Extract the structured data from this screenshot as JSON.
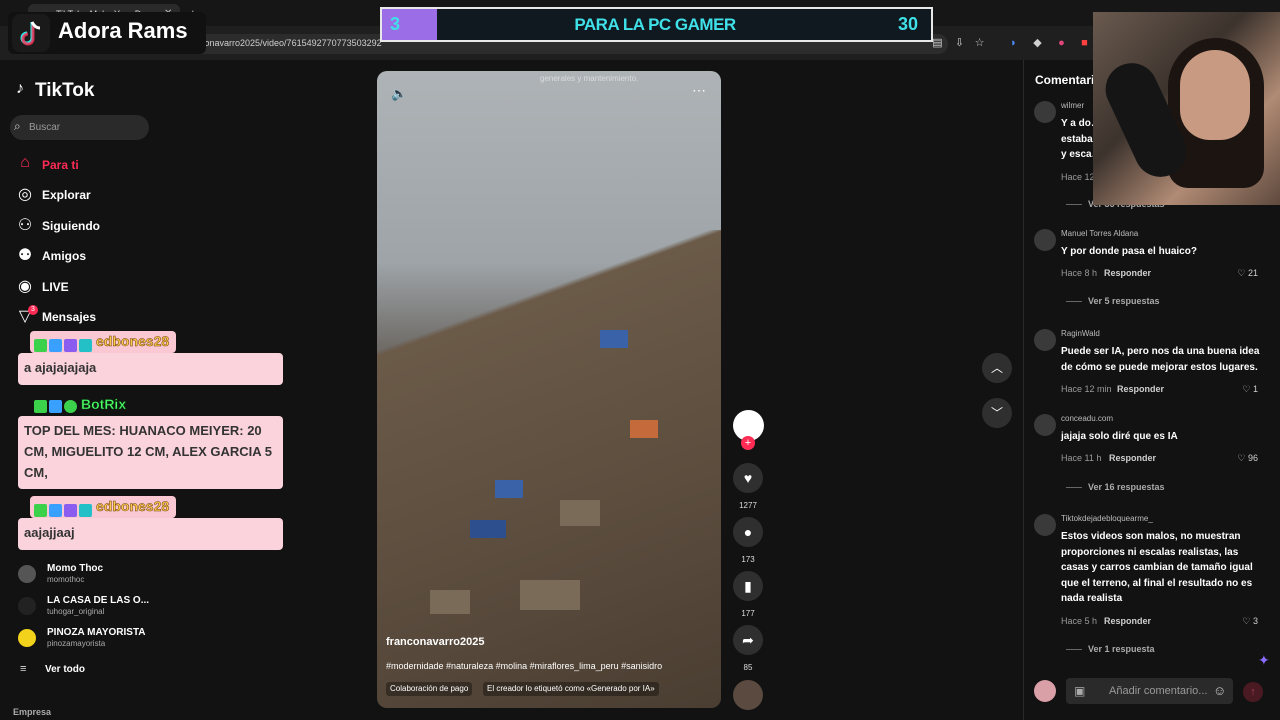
{
  "browser": {
    "tab_title": "TikTok - Make Your Day",
    "url": "conavarro2025/video/7615492770773503292"
  },
  "overlay": {
    "streamer_name": "Adora Rams",
    "goal_current": "3",
    "goal_title": "PARA LA PC GAMER",
    "goal_target": "30",
    "goal_progress": 0.1
  },
  "sidebar": {
    "logo": "TikTok",
    "search_placeholder": "Buscar",
    "nav": [
      {
        "label": "Para ti",
        "icon": "home-icon"
      },
      {
        "label": "Explorar",
        "icon": "compass-icon"
      },
      {
        "label": "Siguiendo",
        "icon": "following-icon"
      },
      {
        "label": "Amigos",
        "icon": "friends-icon"
      },
      {
        "label": "LIVE",
        "icon": "live-icon"
      },
      {
        "label": "Mensajes",
        "icon": "messages-icon",
        "badge": "3"
      }
    ],
    "accounts": [
      {
        "name": "Momo Thoc",
        "handle": "momothoc"
      },
      {
        "name": "LA CASA DE LAS O...",
        "handle": "tuhogar_original"
      },
      {
        "name": "PINOZA MAYORISTA",
        "handle": "pinozamayorista"
      }
    ],
    "see_all": "Ver todo",
    "footer": "Empresa"
  },
  "chat": [
    {
      "user": "edbones28",
      "message": "a ajajajajaja"
    },
    {
      "user": "BotRix",
      "message": "TOP DEL MES: HUANACO MEIYER: 20 CM, MIGUELITO 12 CM, ALEX GARCIA 5 CM,"
    },
    {
      "user": "edbones28",
      "message": "aajajjaaj"
    }
  ],
  "video": {
    "overlay_text": "generales y mantenimiento.",
    "author": "franconavarro2025",
    "hashtags": "#modernidade  #naturaleza #molina #miraflores_lima_peru #sanisidro",
    "chip_paid": "Colaboración de pago",
    "chip_ai": "El creador lo etiquetó como «Generado por IA»",
    "likes": "1277",
    "comments": "173",
    "saves": "177",
    "shares": "85"
  },
  "comments": {
    "title": "Comentarios",
    "items": [
      {
        "user": "wilmer",
        "text": "Y a do… estaba… y esca…",
        "time": "Hace 12",
        "more": "Ver 36 respuestas"
      },
      {
        "user": "Manuel Torres Aldana",
        "text": "Y por donde pasa el huaico?",
        "time": "Hace 8 h",
        "likes": "21",
        "more": "Ver 5 respuestas"
      },
      {
        "user": "RaginWald",
        "text": "Puede ser IA, pero nos da una buena idea de cómo se puede mejorar estos lugares.",
        "time": "Hace 12 min",
        "likes": "1"
      },
      {
        "user": "conceadu.com",
        "text": "jajaja solo diré que es IA",
        "time": "Hace 11 h",
        "likes": "96",
        "more": "Ver 16 respuestas"
      },
      {
        "user": "Tiktokdejadebloquearme_",
        "text": "Estos videos son malos, no muestran proporciones ni escalas realistas, las casas y carros cambian de tamaño igual que el terreno, al final el resultado no es nada realista",
        "time": "Hace 5 h",
        "likes": "3",
        "more": "Ver 1 respuesta"
      }
    ],
    "reply_label": "Responder",
    "composer_placeholder": "Añadir comentario..."
  }
}
